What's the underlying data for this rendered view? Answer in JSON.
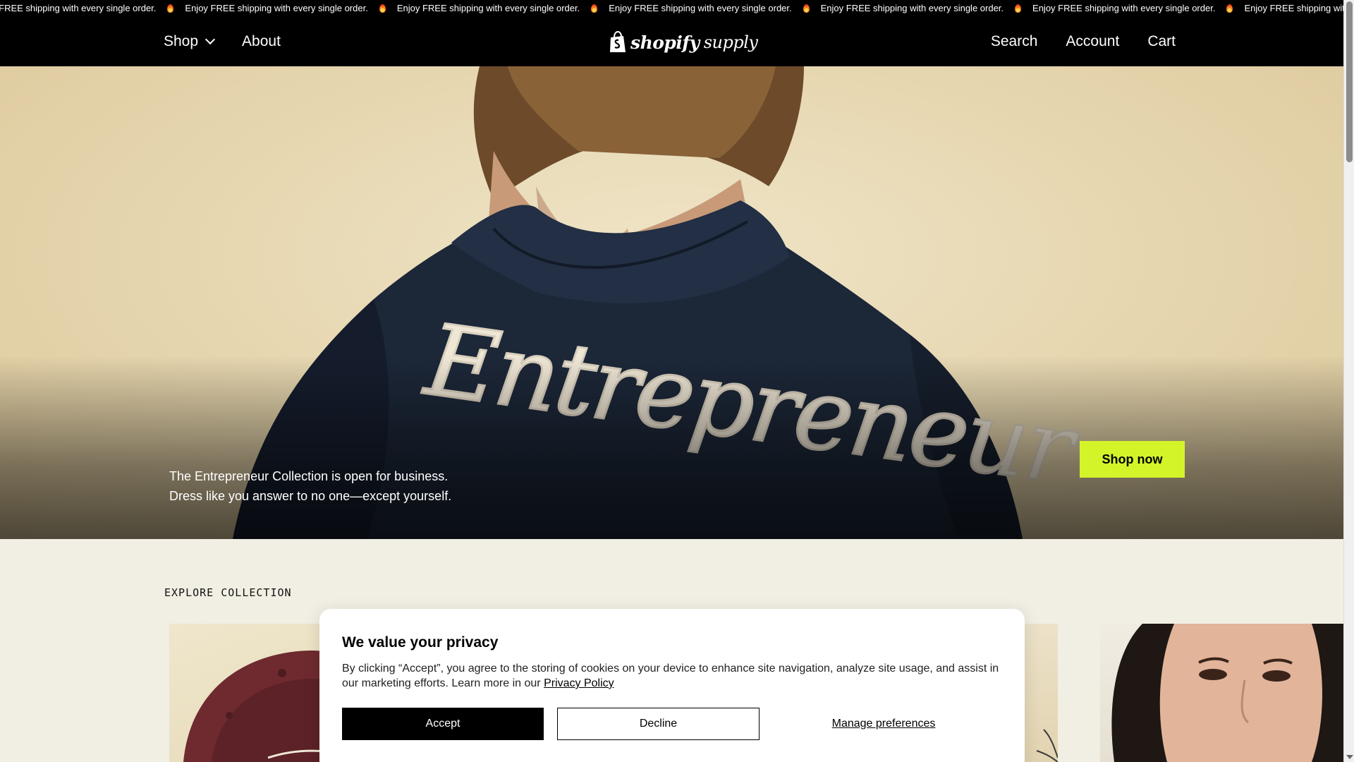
{
  "announcement": {
    "items": [
      "Enjoy FREE shipping with every single order.",
      "Enjoy FREE shipping with every single order.",
      "Enjoy FREE shipping with every single order.",
      "Enjoy FREE shipping with every single order.",
      "Enjoy FREE shipping with every single order.",
      "Enjoy FREE shipping with every single order.",
      "Enjoy FREE shipping with every single order."
    ],
    "icon": "fire-icon"
  },
  "header": {
    "nav_left": {
      "shop": "Shop",
      "about": "About"
    },
    "logo": {
      "word1": "shopify",
      "word2": "supply",
      "icon": "shopping-bag-icon"
    },
    "nav_right": {
      "search": "Search",
      "account": "Account",
      "cart": "Cart"
    }
  },
  "hero": {
    "jacket_text": "Entrepreneur",
    "caption_line1": "The Entrepreneur Collection is open for business.",
    "caption_line2": "Dress like you answer to no one—except yourself.",
    "cta": "Shop now",
    "cta_color": "#d4f42a"
  },
  "explore": {
    "title": "EXPLORE COLLECTION"
  },
  "privacy": {
    "title": "We value your privacy",
    "text_before_link": "By clicking “Accept”, you agree to the storing of cookies on your device to enhance site navigation, analyze site usage, and assist in our marketing efforts. Learn more in our ",
    "link": "Privacy Policy",
    "accept": "Accept",
    "decline": "Decline",
    "manage": "Manage preferences"
  }
}
